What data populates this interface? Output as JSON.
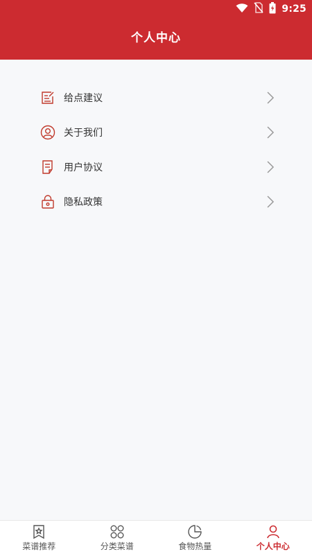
{
  "status_bar": {
    "time": "9:25",
    "icons": [
      "wifi-icon",
      "no-sim-icon",
      "battery-charging-icon"
    ]
  },
  "header": {
    "title": "个人中心"
  },
  "menu": {
    "items": [
      {
        "label": "给点建议",
        "icon": "feedback-edit-icon"
      },
      {
        "label": "关于我们",
        "icon": "user-circle-icon"
      },
      {
        "label": "用户协议",
        "icon": "document-icon"
      },
      {
        "label": "隐私政策",
        "icon": "lock-icon"
      }
    ]
  },
  "bottom_nav": {
    "items": [
      {
        "label": "菜谱推荐",
        "icon": "star-bookmark-icon",
        "active": false
      },
      {
        "label": "分类菜谱",
        "icon": "category-grid-icon",
        "active": false
      },
      {
        "label": "食物热量",
        "icon": "pie-chart-icon",
        "active": false
      },
      {
        "label": "个人中心",
        "icon": "person-icon",
        "active": true
      }
    ]
  },
  "colors": {
    "primary": "#cc2b30",
    "text": "#333333",
    "background": "#f7f8fa",
    "icon_stroke": "#c0392b",
    "chevron": "#999999"
  }
}
